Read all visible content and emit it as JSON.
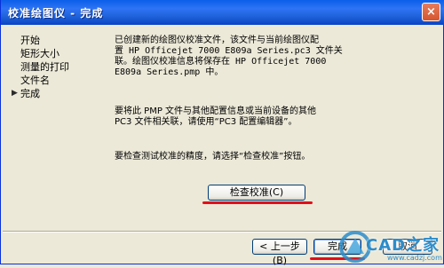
{
  "window": {
    "title": "校准绘图仪 - 完成",
    "close_label": "×"
  },
  "sidebar": {
    "items": [
      {
        "label": "开始",
        "current": false
      },
      {
        "label": "矩形大小",
        "current": false
      },
      {
        "label": "测量的打印",
        "current": false
      },
      {
        "label": "文件名",
        "current": false
      },
      {
        "label": "完成",
        "current": true
      }
    ],
    "current_marker": "▶"
  },
  "content": {
    "para1_line1": "已创建新的绘图仪校准文件，该文件与当前绘图仪配",
    "para1_line2": "置 HP Officejet 7000 E809a Series.pc3 文件关",
    "para1_line3": "联。绘图仪校准信息将保存在 HP Officejet 7000",
    "para1_line4": "E809a Series.pmp 中。",
    "para2_line1": "要将此 PMP 文件与其他配置信息或当前设备的其他",
    "para2_line2": "PC3 文件相关联，请使用“PC3 配置编辑器”。",
    "para3": "要检查测试校准的精度，请选择“检查校准”按钮。"
  },
  "buttons": {
    "check_calibration": "检查校准(C)",
    "back": "< 上一步(B)",
    "finish": "完成",
    "cancel": "取消"
  },
  "watermark": {
    "text": "CAD之家",
    "url": "www.cadzj.com"
  }
}
